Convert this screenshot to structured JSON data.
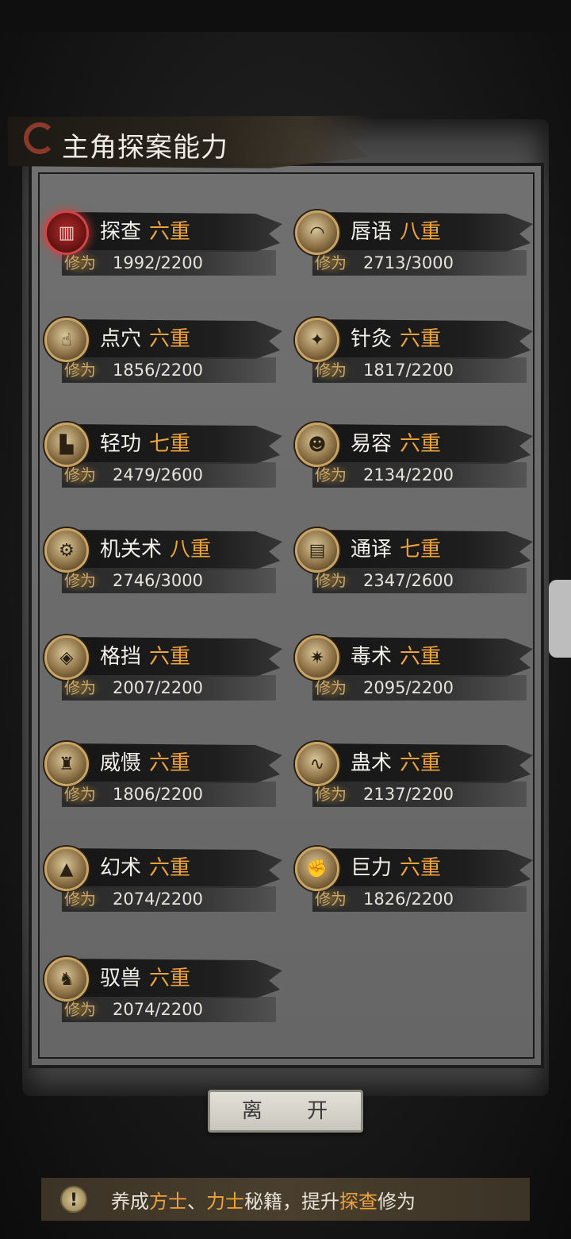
{
  "header": {
    "title": "主角探案能力"
  },
  "labels": {
    "xiuwei": "修为"
  },
  "skills": [
    {
      "name": "探查",
      "level": "六重",
      "progress": "1992/2200",
      "icon": "lantern-icon"
    },
    {
      "name": "唇语",
      "level": "八重",
      "progress": "2713/3000",
      "icon": "mouth-icon"
    },
    {
      "name": "点穴",
      "level": "六重",
      "progress": "1856/2200",
      "icon": "finger-icon"
    },
    {
      "name": "针灸",
      "level": "六重",
      "progress": "1817/2200",
      "icon": "needle-icon"
    },
    {
      "name": "轻功",
      "level": "七重",
      "progress": "2479/2600",
      "icon": "boot-icon"
    },
    {
      "name": "易容",
      "level": "六重",
      "progress": "2134/2200",
      "icon": "mask-icon"
    },
    {
      "name": "机关术",
      "level": "八重",
      "progress": "2746/3000",
      "icon": "gear-icon"
    },
    {
      "name": "通译",
      "level": "七重",
      "progress": "2347/2600",
      "icon": "scroll-icon"
    },
    {
      "name": "格挡",
      "level": "六重",
      "progress": "2007/2200",
      "icon": "shield-icon"
    },
    {
      "name": "毒术",
      "level": "六重",
      "progress": "2095/2200",
      "icon": "spider-icon"
    },
    {
      "name": "威慑",
      "level": "六重",
      "progress": "1806/2200",
      "icon": "warrior-icon"
    },
    {
      "name": "蛊术",
      "level": "六重",
      "progress": "2137/2200",
      "icon": "worm-icon"
    },
    {
      "name": "幻术",
      "level": "六重",
      "progress": "2074/2200",
      "icon": "hood-icon"
    },
    {
      "name": "巨力",
      "level": "六重",
      "progress": "1826/2200",
      "icon": "fist-icon"
    },
    {
      "name": "驭兽",
      "level": "六重",
      "progress": "2074/2200",
      "icon": "wolf-icon"
    }
  ],
  "leave_button": "离 开",
  "tip": {
    "icon": "exclamation-icon",
    "part1": "养成",
    "hl1": "方士",
    "sep": "、",
    "hl2": "力士",
    "part2": "秘籍，提升",
    "hl3": "探查",
    "part3": "修为"
  }
}
